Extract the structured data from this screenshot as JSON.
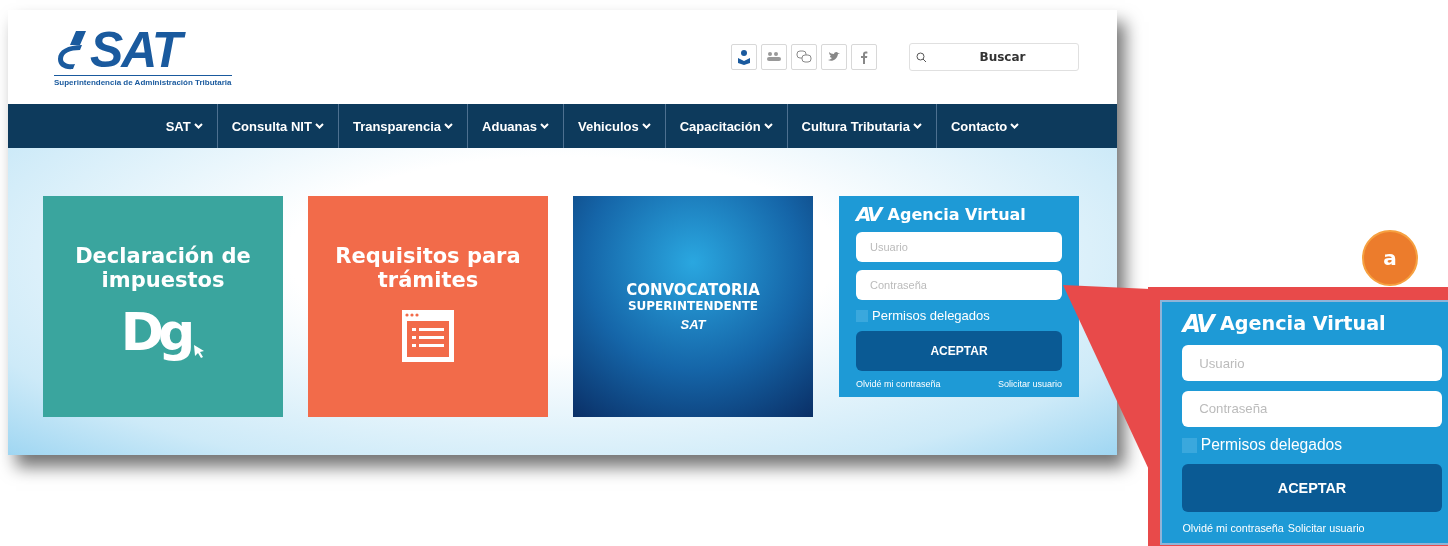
{
  "header": {
    "logo": {
      "name": "SAT",
      "tagline": "Superintendencia de Administración Tributaria"
    },
    "social_icons": [
      {
        "kind": "portal"
      },
      {
        "kind": "community"
      },
      {
        "kind": "chat"
      },
      {
        "kind": "twitter"
      },
      {
        "kind": "facebook"
      }
    ],
    "search": {
      "placeholder": "Buscar"
    }
  },
  "nav": {
    "items": [
      {
        "label": "SAT"
      },
      {
        "label": "Consulta NIT"
      },
      {
        "label": "Transparencia"
      },
      {
        "label": "Aduanas"
      },
      {
        "label": "Vehiculos"
      },
      {
        "label": "Capacitación"
      },
      {
        "label": "Cultura Tributaria"
      },
      {
        "label": "Contacto"
      }
    ]
  },
  "tiles": [
    {
      "kind": "declaration",
      "title": "Declaración de impuestos",
      "icon_text": "Dg",
      "color": "#3aa59e"
    },
    {
      "kind": "requirements",
      "title": "Requisitos para trámites",
      "color": "#f26b4a"
    },
    {
      "kind": "banner",
      "title": "CONVOCATORIA",
      "subtitle": "SUPERINTENDENTE",
      "logo": "SAT",
      "color": "#1565a8"
    }
  ],
  "login": {
    "logo_text": "AV",
    "title": "Agencia Virtual",
    "username": {
      "placeholder": "Usuario"
    },
    "password": {
      "placeholder": "Contraseña"
    },
    "delegated": {
      "label": "Permisos delegados",
      "checked": false
    },
    "submit": "ACEPTAR",
    "links": [
      "Olvidé mi contraseña",
      "Solicitar usuario"
    ]
  },
  "callout": {
    "badge": "a",
    "login": {
      "logo_text": "AV",
      "title": "Agencia Virtual",
      "username": {
        "placeholder": "Usuario"
      },
      "password": {
        "placeholder": "Contraseña"
      },
      "delegated": {
        "label": "Permisos delegados",
        "checked": false
      },
      "submit": "ACEPTAR",
      "links": [
        "Olvidé mi contraseña",
        "Solicitar usuario"
      ]
    }
  }
}
